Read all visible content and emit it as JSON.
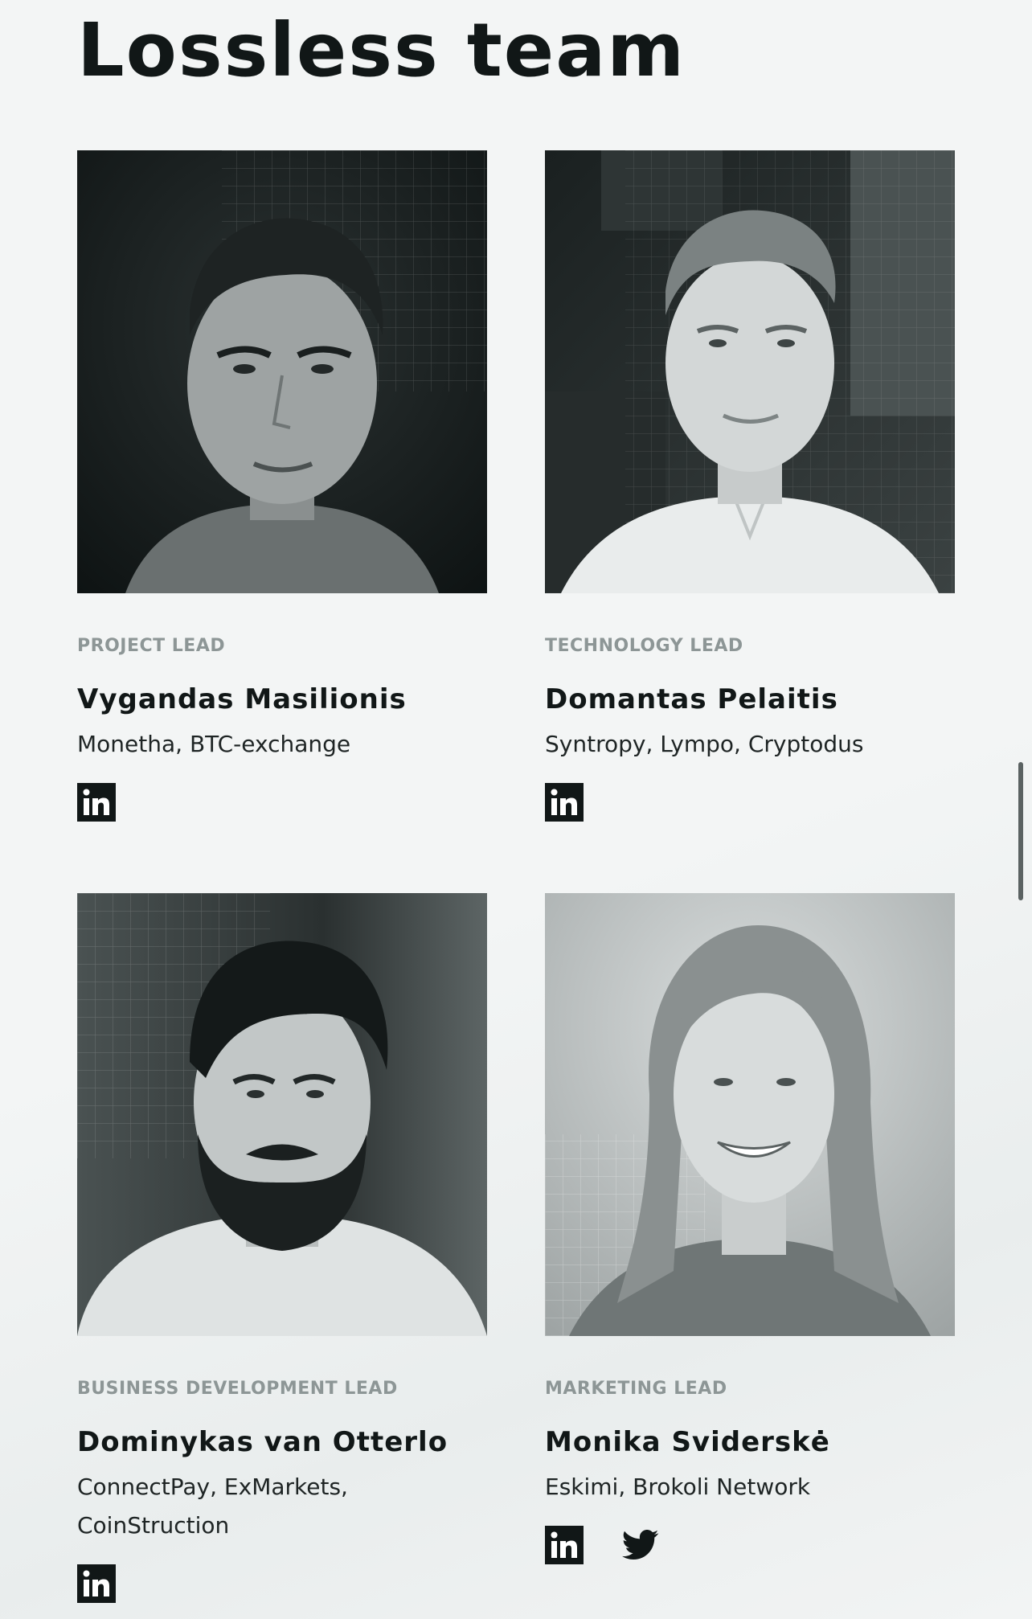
{
  "page": {
    "title": "Lossless team"
  },
  "team": [
    {
      "role": "PROJECT LEAD",
      "name": "Vygandas Masilionis",
      "companies": "Monetha, BTC-exchange",
      "socials": [
        "linkedin-icon"
      ]
    },
    {
      "role": "TECHNOLOGY LEAD",
      "name": "Domantas Pelaitis",
      "companies": "Syntropy, Lympo, Cryptodus",
      "socials": [
        "linkedin-icon"
      ]
    },
    {
      "role": "BUSINESS DEVELOPMENT LEAD",
      "name": "Dominykas van Otterlo",
      "companies": "ConnectPay, ExMarkets, CoinStruction",
      "socials": [
        "linkedin-icon"
      ]
    },
    {
      "role": "MARKETING LEAD",
      "name": "Monika Sviderskė",
      "companies": "Eskimi, Brokoli Network",
      "socials": [
        "linkedin-icon",
        "twitter-icon"
      ]
    }
  ],
  "colors": {
    "background": "#f3f5f5",
    "text": "#111717",
    "role_text": "#8d9696",
    "icon": "#111717"
  }
}
